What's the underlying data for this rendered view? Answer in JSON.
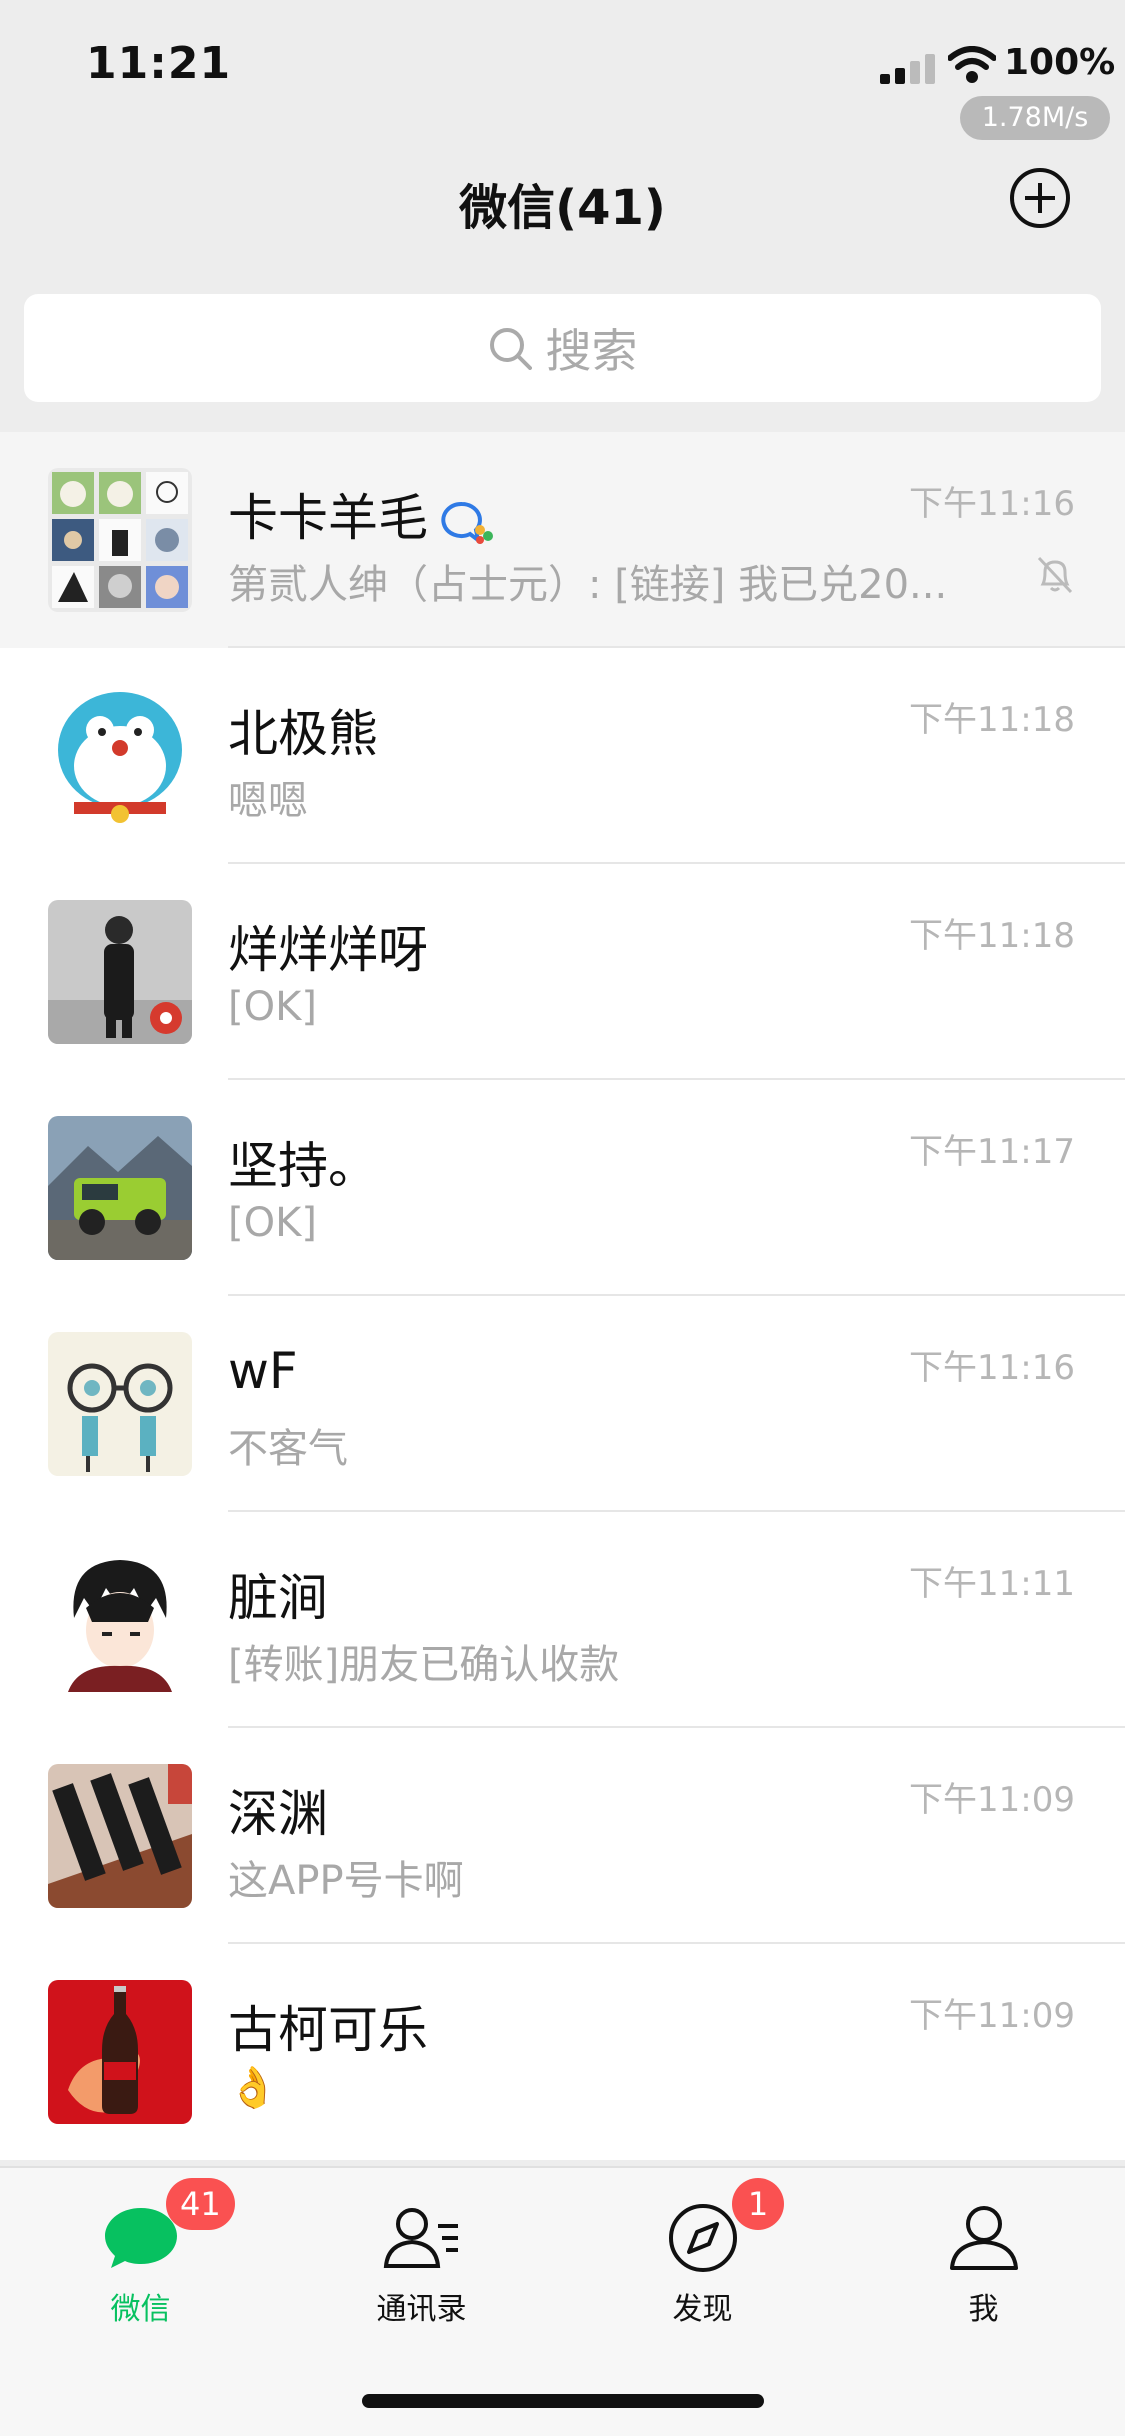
{
  "status_bar": {
    "time": "11:21",
    "battery": "100%",
    "network_speed": "1.78M/s"
  },
  "nav": {
    "title": "微信(41)"
  },
  "search": {
    "placeholder": "搜索"
  },
  "chats": [
    {
      "name": "卡卡羊毛",
      "message": "第贰人绅（占士元）: [链接] 我已兑20...",
      "time": "下午11:16",
      "muted": true
    },
    {
      "name": "北极熊",
      "message": "嗯嗯",
      "time": "下午11:18"
    },
    {
      "name": "烊烊烊呀",
      "message": "[OK]",
      "time": "下午11:18"
    },
    {
      "name": "坚持。",
      "message": "[OK]",
      "time": "下午11:17"
    },
    {
      "name": "wF",
      "message": "不客气",
      "time": "下午11:16"
    },
    {
      "name": "脏涧",
      "message": "[转账]朋友已确认收款",
      "time": "下午11:11"
    },
    {
      "name": "深渊",
      "message": "这APP号卡啊",
      "time": "下午11:09"
    },
    {
      "name": "古柯可乐",
      "message": "👌",
      "time": "下午11:09"
    }
  ],
  "tabs": [
    {
      "label": "微信",
      "badge": "41",
      "icon": "chat-bubble-icon"
    },
    {
      "label": "通讯录",
      "icon": "contacts-icon"
    },
    {
      "label": "发现",
      "badge": "1",
      "icon": "compass-icon"
    },
    {
      "label": "我",
      "icon": "person-icon"
    }
  ],
  "colors": {
    "accent": "#07c160",
    "badge": "#fa5151"
  }
}
